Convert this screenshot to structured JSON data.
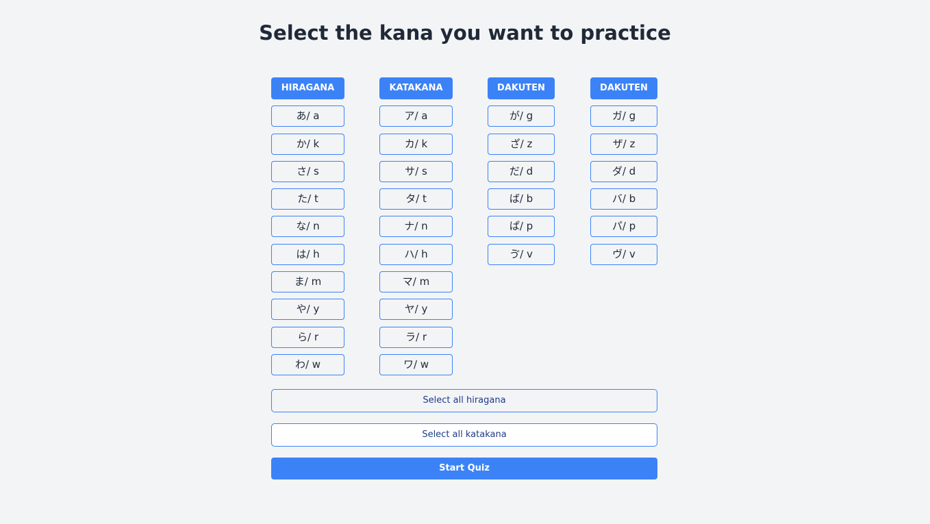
{
  "title": "Select the kana you want to practice",
  "colors": {
    "accent": "#3b82f6",
    "background": "#f3f4f6",
    "text": "#1f2937",
    "link_text": "#1e3a8a"
  },
  "columns": [
    {
      "header": "HIRAGANA",
      "items": [
        "あ/ a",
        "か/ k",
        "さ/ s",
        "た/ t",
        "な/ n",
        "は/ h",
        "ま/ m",
        "や/ y",
        "ら/ r",
        "わ/ w"
      ]
    },
    {
      "header": "KATAKANA",
      "items": [
        "ア/ a",
        "カ/ k",
        "サ/ s",
        "タ/ t",
        "ナ/ n",
        "ハ/ h",
        "マ/ m",
        "ヤ/ y",
        "ラ/ r",
        "ワ/ w"
      ]
    },
    {
      "header": "DAKUTEN",
      "items": [
        "が/ g",
        "ざ/ z",
        "だ/ d",
        "ば/ b",
        "ぱ/ p",
        "ゔ/ v"
      ]
    },
    {
      "header": "DAKUTEN",
      "items": [
        "ガ/ g",
        "ザ/ z",
        "ダ/ d",
        "バ/ b",
        "パ/ p",
        "ヴ/ v"
      ]
    }
  ],
  "actions": {
    "select_all_hiragana": "Select all hiragana",
    "select_all_katakana": "Select all katakana",
    "start_quiz": "Start Quiz"
  }
}
